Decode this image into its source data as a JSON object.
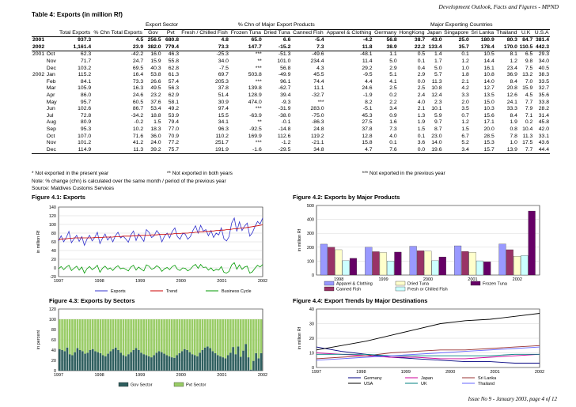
{
  "header": {
    "right": "Development Outlook, Facts and Figures - MPND"
  },
  "table": {
    "title": "Table 4: Exports  (in million Rf)",
    "groups": {
      "export_sector": "Export Sector",
      "change": "% Chn of Major Export Products",
      "destinations": "Major Exporting Countries"
    },
    "col_headers": [
      "Total Exports",
      "% Chn Total Exports",
      "Gov",
      "Pvt",
      "Fresh / Chilled Fish",
      "Frozen Tuna",
      "Dried Tuna",
      "Canned Fish",
      "Apparel & Clothing",
      "Germany",
      "HongKong",
      "Japan",
      "Singapore",
      "Sri Lanka",
      "Thailand",
      "U.K",
      "U.S.A"
    ],
    "rows": [
      {
        "yr": "2001",
        "mo": "",
        "v": [
          "937.3",
          "4.5",
          "256.5",
          "680.8",
          "4.8",
          "65.0",
          "6.6",
          "-5.4",
          "-4.2",
          "56.8",
          "38.7",
          "43.0",
          "25.0",
          "180.9",
          "80.3",
          "84.7",
          "381.4"
        ],
        "bold": true
      },
      {
        "yr": "2002",
        "mo": "",
        "v": [
          "1,161.4",
          "23.9",
          "382.0",
          "779.4",
          "73.3",
          "147.7",
          "-15.2",
          "7.3",
          "11.8",
          "38.9",
          "22.2",
          "133.4",
          "35.7",
          "178.4",
          "170.0",
          "110.5",
          "442.3"
        ],
        "bold": true
      },
      {
        "yr": "2001",
        "mo": "Oct",
        "v": [
          "62.3",
          "-42.2",
          "16.0",
          "46.3",
          "-25.3",
          "***",
          "-51.3",
          "-49.6",
          "-48.1",
          "1.1",
          "0.5",
          "1.4",
          "0.1",
          "10.5",
          "8.1",
          "6.5",
          "29.3"
        ]
      },
      {
        "yr": "",
        "mo": "Nov",
        "v": [
          "71.7",
          "24.7",
          "15.9",
          "55.8",
          "34.0",
          "**",
          "101.0",
          "234.4",
          "11.4",
          "5.0",
          "0.1",
          "1.7",
          "1.2",
          "14.4",
          "1.2",
          "9.8",
          "34.0"
        ]
      },
      {
        "yr": "",
        "mo": "Dec",
        "v": [
          "103.2",
          "69.5",
          "40.3",
          "62.8",
          "-7.5",
          "***",
          "56.8",
          "4.3",
          "29.2",
          "2.9",
          "0.4",
          "5.0",
          "1.0",
          "16.1",
          "23.4",
          "7.5",
          "40.5"
        ]
      },
      {
        "yr": "2002",
        "mo": "Jan",
        "v": [
          "115.2",
          "16.4",
          "53.8",
          "61.3",
          "69.7",
          "503.8",
          "-49.9",
          "45.5",
          "-9.5",
          "5.1",
          "2.9",
          "5.7",
          "1.8",
          "10.8",
          "36.9",
          "13.2",
          "38.3"
        ]
      },
      {
        "yr": "",
        "mo": "Feb",
        "v": [
          "84.1",
          "73.3",
          "26.6",
          "57.4",
          "205.3",
          "***",
          "96.1",
          "74.4",
          "4.4",
          "4.1",
          "0.0",
          "11.3",
          "2.1",
          "14.0",
          "8.4",
          "7.0",
          "33.5"
        ]
      },
      {
        "yr": "",
        "mo": "Mar",
        "v": [
          "105.9",
          "16.3",
          "49.5",
          "56.3",
          "37.8",
          "139.8",
          "-62.7",
          "11.1",
          "24.6",
          "2.5",
          "2.5",
          "10.8",
          "4.2",
          "12.7",
          "20.8",
          "15.9",
          "32.7"
        ]
      },
      {
        "yr": "",
        "mo": "Apr",
        "v": [
          "86.0",
          "24.6",
          "23.2",
          "62.9",
          "51.4",
          "128.9",
          "39.4",
          "-32.7",
          "-1.9",
          "0.2",
          "2.4",
          "12.4",
          "3.3",
          "13.5",
          "12.6",
          "4.5",
          "35.6"
        ]
      },
      {
        "yr": "",
        "mo": "May",
        "v": [
          "95.7",
          "60.5",
          "37.6",
          "58.1",
          "30.9",
          "474.0",
          "-9.3",
          "***",
          "8.2",
          "2.2",
          "4.0",
          "2.3",
          "2.0",
          "15.0",
          "24.1",
          "7.7",
          "33.8"
        ]
      },
      {
        "yr": "",
        "mo": "Jun",
        "v": [
          "102.6",
          "86.7",
          "53.4",
          "49.2",
          "97.4",
          "***",
          "-31.9",
          "283.0",
          "-5.1",
          "3.4",
          "2.1",
          "10.1",
          "3.5",
          "10.3",
          "33.3",
          "7.9",
          "28.2"
        ]
      },
      {
        "yr": "",
        "mo": "Jul",
        "v": [
          "72.8",
          "-34.2",
          "18.8",
          "53.9",
          "15.5",
          "-63.9",
          "-38.0",
          "-75.0",
          "45.3",
          "0.9",
          "1.3",
          "5.9",
          "0.7",
          "15.6",
          "8.4",
          "7.1",
          "31.4"
        ]
      },
      {
        "yr": "",
        "mo": "Aug",
        "v": [
          "80.9",
          "-0.2",
          "1.5",
          "79.4",
          "34.1",
          "**",
          "-0.1",
          "-86.3",
          "27.5",
          "1.6",
          "1.9",
          "9.7",
          "1.2",
          "17.1",
          "1.9",
          "0.2",
          "45.8"
        ]
      },
      {
        "yr": "",
        "mo": "Sep",
        "v": [
          "95.3",
          "10.2",
          "18.3",
          "77.0",
          "96.3",
          "-92.5",
          "-14.8",
          "24.8",
          "37.8",
          "7.3",
          "1.5",
          "8.7",
          "1.5",
          "20.0",
          "0.8",
          "10.4",
          "42.0"
        ]
      },
      {
        "yr": "",
        "mo": "Oct",
        "v": [
          "107.0",
          "71.6",
          "36.0",
          "70.9",
          "110.2",
          "169.9",
          "112.6",
          "119.2",
          "12.8",
          "4.0",
          "0.1",
          "23.0",
          "6.7",
          "28.5",
          "7.8",
          "11.3",
          "33.1"
        ]
      },
      {
        "yr": "",
        "mo": "Nov",
        "v": [
          "101.2",
          "41.2",
          "24.0",
          "77.2",
          "251.7",
          "***",
          "-1.2",
          "-21.1",
          "15.8",
          "0.1",
          "3.6",
          "14.0",
          "5.2",
          "15.3",
          "1.0",
          "17.5",
          "43.6"
        ]
      },
      {
        "yr": "",
        "mo": "Dec",
        "v": [
          "114.9",
          "11.3",
          "39.2",
          "75.7",
          "191.9",
          "-1.6",
          "-29.5",
          "34.8",
          "4.7",
          "7.6",
          "0.0",
          "19.6",
          "3.4",
          "15.7",
          "13.9",
          "7.7",
          "44.4"
        ]
      }
    ]
  },
  "notes": {
    "n1": "* Not exported in the present year",
    "n2": "** Not exported in both years",
    "n3": "*** Not exported in the previous year",
    "n4": "Note: % change (chn) is calculated over the same month / period of the previous year",
    "n5": "Source: Maldives Customs Services"
  },
  "figures": {
    "f1": "Figure 4.1: Exports",
    "f2": "Figure 4.2: Exports by Major Products",
    "f3": "Figure 4.3: Exports by Sectors",
    "f4": "Figure 4.4: Export Trends by Major Destinations"
  },
  "chart_data": [
    {
      "type": "line",
      "title": "Figure 4.1: Exports",
      "ylabel": "in million Rf",
      "x_ticks": [
        "1997",
        "1998",
        "1999",
        "2000",
        "2001",
        "2002"
      ],
      "ylim": [
        -20,
        140
      ],
      "y_ticks": [
        -20,
        0,
        20,
        40,
        60,
        80,
        100,
        120,
        140
      ],
      "series": [
        {
          "name": "Exports",
          "color": "#3333cc",
          "values": [
            62,
            74,
            60,
            70,
            84,
            58,
            67,
            75,
            61,
            72,
            52,
            66,
            75,
            62,
            70,
            82,
            56,
            68,
            78,
            64,
            72,
            60,
            74,
            82,
            69,
            73,
            67,
            59,
            76,
            85,
            63,
            78,
            70,
            61,
            88,
            82,
            70,
            74,
            86,
            78,
            60,
            73,
            80,
            69,
            84,
            92,
            72,
            66,
            79,
            78,
            66,
            72,
            86,
            97,
            80,
            98,
            85,
            88,
            74,
            86,
            70,
            80,
            76,
            92,
            67,
            62,
            72,
            103,
            115,
            84,
            106,
            86,
            96,
            103,
            73,
            81,
            95,
            107,
            101,
            115
          ]
        },
        {
          "name": "Trend",
          "color": "#cc0000",
          "values": [
            65,
            66,
            67,
            67,
            68,
            68,
            69,
            69,
            69,
            69,
            69,
            69,
            69,
            69,
            70,
            70,
            70,
            70,
            71,
            71,
            71,
            71,
            72,
            72,
            72,
            73,
            73,
            73,
            73,
            74,
            74,
            74,
            75,
            75,
            75,
            75,
            76,
            76,
            76,
            77,
            77,
            77,
            78,
            78,
            78,
            79,
            79,
            79,
            80,
            80,
            80,
            81,
            81,
            82,
            82,
            83,
            83,
            84,
            84,
            85,
            85,
            86,
            86,
            87,
            87,
            88,
            88,
            89,
            90,
            90,
            91,
            92,
            92,
            93,
            94,
            95,
            96,
            97,
            98,
            99
          ]
        },
        {
          "name": "Business Cycle",
          "color": "#009900",
          "values": [
            -2,
            3,
            -4,
            2,
            6,
            -6,
            -1,
            4,
            -5,
            2,
            -12,
            -2,
            3,
            -4,
            0,
            6,
            -10,
            -1,
            4,
            -3,
            0,
            -6,
            1,
            5,
            -2,
            0,
            -3,
            -7,
            2,
            6,
            -5,
            2,
            -3,
            -7,
            7,
            4,
            -3,
            -1,
            5,
            1,
            -8,
            -2,
            1,
            -4,
            3,
            6,
            -3,
            -6,
            0,
            -1,
            -7,
            -3,
            4,
            8,
            -1,
            8,
            1,
            2,
            -5,
            0,
            -7,
            -3,
            -5,
            3,
            -10,
            -12,
            -8,
            7,
            12,
            -3,
            7,
            -3,
            2,
            4,
            -12,
            -9,
            -1,
            6,
            2,
            8
          ]
        }
      ]
    },
    {
      "type": "bar",
      "title": "Figure 4.2: Exports by Major Products",
      "ylabel": "in million Rf",
      "categories": [
        "1998",
        "1999",
        "2000",
        "2001",
        "2002"
      ],
      "ylim": [
        0,
        500
      ],
      "y_ticks": [
        0,
        100,
        200,
        300,
        400,
        500
      ],
      "series": [
        {
          "name": "Apparel & Clothing",
          "color": "#9999ff",
          "values": [
            222,
            200,
            207,
            210,
            223
          ]
        },
        {
          "name": "Canned Fish",
          "color": "#993366",
          "values": [
            200,
            168,
            175,
            170,
            182
          ]
        },
        {
          "name": "Dried Tuna",
          "color": "#ffffcc",
          "values": [
            182,
            162,
            172,
            163,
            135
          ]
        },
        {
          "name": "Fresh or Chilled Fish",
          "color": "#ccffff",
          "values": [
            103,
            100,
            103,
            102,
            140
          ]
        },
        {
          "name": "Frozen Tuna",
          "color": "#660066",
          "values": [
            120,
            165,
            130,
            95,
            460
          ]
        }
      ]
    },
    {
      "type": "bar",
      "stacked": true,
      "title": "Figure 4.3: Exports by Sectors",
      "ylabel": "in percent",
      "x_ticks": [
        "1997",
        "1998",
        "1999",
        "2000",
        "2001",
        "2002"
      ],
      "ylim": [
        0,
        120
      ],
      "y_ticks": [
        0,
        20,
        40,
        60,
        80,
        100,
        120
      ],
      "series": [
        {
          "name": "Gov Sector",
          "color": "#2f5f5f",
          "values": [
            42,
            40,
            38,
            45,
            32,
            30,
            36,
            44,
            40,
            38,
            33,
            35,
            40,
            42,
            38,
            36,
            34,
            30,
            28,
            33,
            38,
            42,
            45,
            40,
            35,
            30,
            28,
            32,
            36,
            40,
            44,
            40,
            35,
            32,
            30,
            28,
            26,
            30,
            35,
            38,
            36,
            33,
            30,
            28,
            26,
            25,
            30,
            34,
            38,
            42,
            40,
            36,
            32,
            30,
            28,
            35,
            40,
            45,
            47,
            44,
            38,
            34,
            30,
            28,
            26,
            24,
            30,
            35,
            46,
            32,
            47,
            27,
            39,
            52,
            26,
            2,
            19,
            34,
            24,
            34
          ]
        },
        {
          "name": "Pvt Sector",
          "color": "#99cc66"
        }
      ]
    },
    {
      "type": "line",
      "title": "Figure 4.4: Export Trends by Major Destinations",
      "ylabel": "in million Rf",
      "x_ticks": [
        "1997",
        "1998",
        "1999",
        "2000",
        "2001",
        "2002"
      ],
      "ylim": [
        0,
        40
      ],
      "y_ticks": [
        0,
        10,
        20,
        30,
        40
      ],
      "series": [
        {
          "name": "Germany",
          "color": "#000080",
          "values": [
            14,
            11,
            9,
            7,
            6,
            5,
            4,
            4,
            3,
            3
          ]
        },
        {
          "name": "Japan",
          "color": "#cc0099",
          "values": [
            10,
            9,
            8,
            7,
            7,
            6,
            6,
            7,
            8,
            9
          ]
        },
        {
          "name": "Sri Lanka",
          "color": "#993333",
          "values": [
            6,
            7,
            8,
            10,
            11,
            12,
            12,
            13,
            14,
            15
          ]
        },
        {
          "name": "USA",
          "color": "#000000",
          "values": [
            12,
            15,
            18,
            22,
            26,
            30,
            32,
            33,
            35,
            37
          ]
        },
        {
          "name": "UK",
          "color": "#008080",
          "values": [
            9,
            9,
            9,
            8,
            8,
            8,
            8,
            8,
            9,
            9
          ]
        },
        {
          "name": "Thailand",
          "color": "#6666ff",
          "values": [
            5,
            6,
            7,
            8,
            9,
            10,
            11,
            12,
            13,
            14
          ]
        }
      ]
    }
  ],
  "footer": "Issue No 9 - January 2003, page 4 of 12"
}
